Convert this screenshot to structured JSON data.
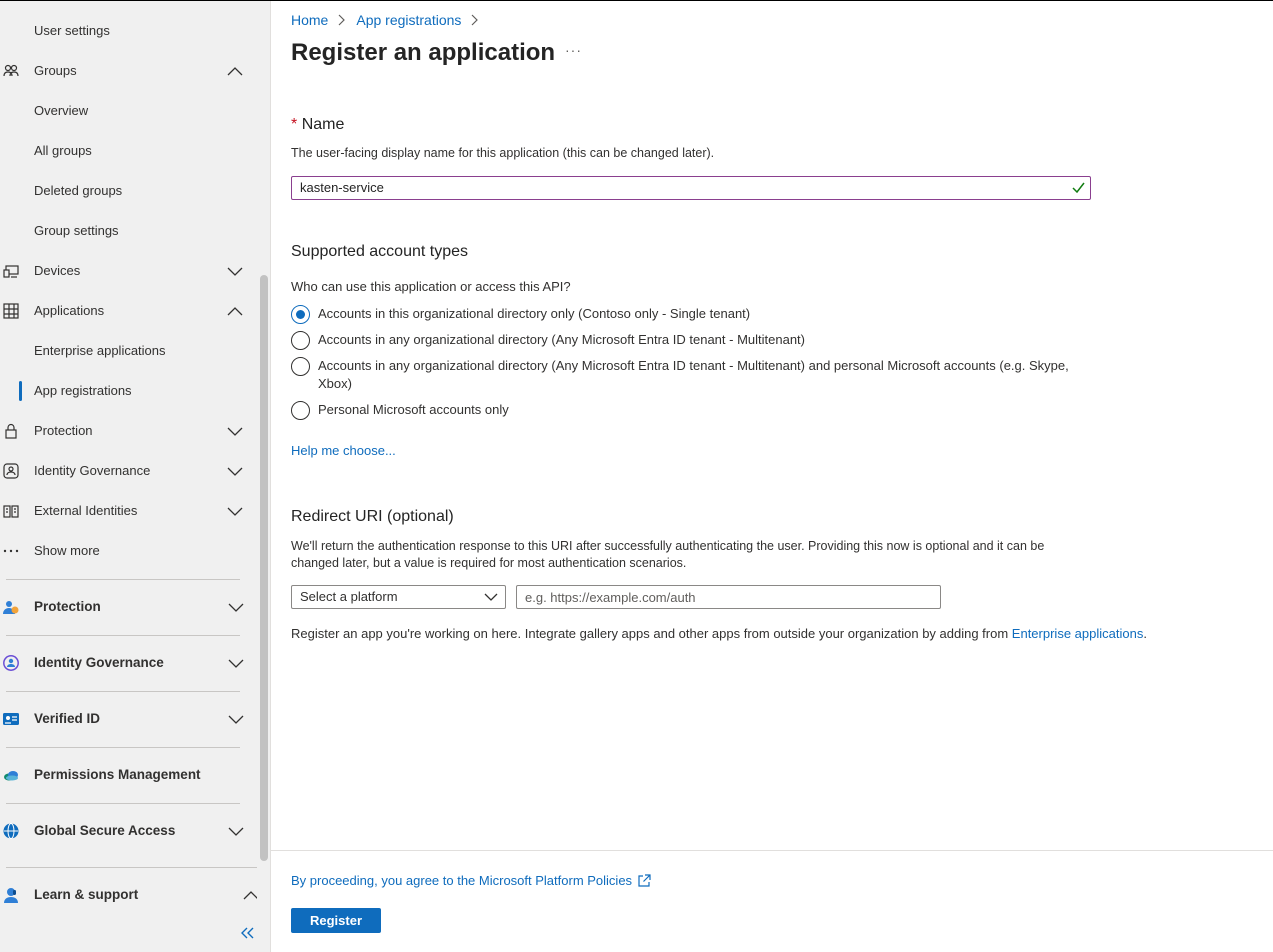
{
  "sidebar": {
    "items": [
      {
        "label": "User settings"
      },
      {
        "label": "Groups"
      },
      {
        "label": "Overview"
      },
      {
        "label": "All groups"
      },
      {
        "label": "Deleted groups"
      },
      {
        "label": "Group settings"
      },
      {
        "label": "Devices"
      },
      {
        "label": "Applications"
      },
      {
        "label": "Enterprise applications"
      },
      {
        "label": "App registrations"
      },
      {
        "label": "Protection"
      },
      {
        "label": "Identity Governance"
      },
      {
        "label": "External Identities"
      },
      {
        "label": "Show more"
      }
    ],
    "sections": [
      {
        "label": "Protection"
      },
      {
        "label": "Identity Governance"
      },
      {
        "label": "Verified ID"
      },
      {
        "label": "Permissions Management"
      },
      {
        "label": "Global Secure Access"
      },
      {
        "label": "Learn & support"
      }
    ],
    "colors": {
      "protection": "#2f7fd6",
      "identity_governance": "#6b4fd6",
      "verified_id": "#0f6cbd",
      "permissions": "#0f8a6f",
      "global": "#0f6cbd",
      "learn": "#2f7fd6"
    }
  },
  "breadcrumb": {
    "home": "Home",
    "app_registrations": "App registrations"
  },
  "page": {
    "title": "Register an application",
    "more": "···"
  },
  "name_section": {
    "required_mark": "*",
    "label": "Name",
    "description": "The user-facing display name for this application (this can be changed later).",
    "value": "kasten-service"
  },
  "account_types": {
    "heading": "Supported account types",
    "question": "Who can use this application or access this API?",
    "options": [
      {
        "label": "Accounts in this organizational directory only (Contoso only - Single tenant)",
        "selected": true
      },
      {
        "label": "Accounts in any organizational directory (Any Microsoft Entra ID tenant - Multitenant)",
        "selected": false
      },
      {
        "label": "Accounts in any organizational directory (Any Microsoft Entra ID tenant - Multitenant) and personal Microsoft accounts (e.g. Skype, Xbox)",
        "selected": false
      },
      {
        "label": "Personal Microsoft accounts only",
        "selected": false
      }
    ],
    "help_link": "Help me choose..."
  },
  "redirect": {
    "heading": "Redirect URI (optional)",
    "description": "We'll return the authentication response to this URI after successfully authenticating the user. Providing this now is optional and it can be changed later, but a value is required for most authentication scenarios.",
    "platform_select": "Select a platform",
    "uri_placeholder": "e.g. https://example.com/auth"
  },
  "register_note": {
    "text": "Register an app you're working on here. Integrate gallery apps and other apps from outside your organization by adding from ",
    "link": "Enterprise applications",
    "end": "."
  },
  "footer": {
    "policy_link": "By proceeding, you agree to the Microsoft Platform Policies",
    "register_button": "Register"
  }
}
